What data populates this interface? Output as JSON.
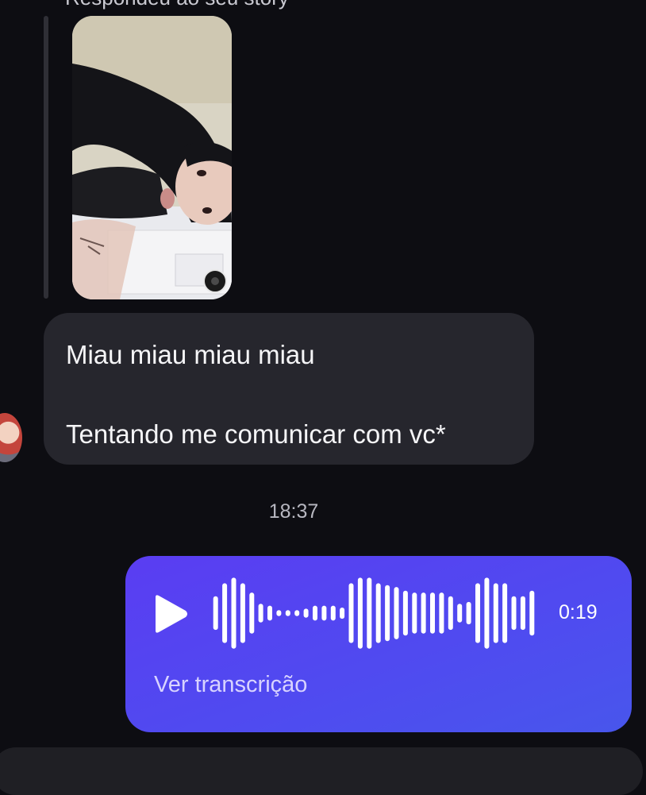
{
  "reply_header": {
    "text": "Respondeu ao seu story"
  },
  "story": {
    "thumbnail_icon": "story-photo",
    "badge_icon": "camera-lens-icon"
  },
  "incoming_message": {
    "line1": "Miau miau miau miau",
    "line2": "Tentando me comunicar com vc*"
  },
  "timestamp": "18:37",
  "voice_message": {
    "play_icon": "play-icon",
    "duration": "0:19",
    "transcript_link": "Ver transcrição",
    "waveform_levels": [
      0.45,
      0.8,
      0.95,
      0.8,
      0.55,
      0.25,
      0.2,
      0.08,
      0.08,
      0.08,
      0.12,
      0.2,
      0.2,
      0.2,
      0.15,
      0.8,
      0.95,
      0.95,
      0.8,
      0.75,
      0.7,
      0.6,
      0.55,
      0.55,
      0.55,
      0.55,
      0.45,
      0.25,
      0.3,
      0.8,
      0.95,
      0.8,
      0.8,
      0.45,
      0.45,
      0.6
    ]
  },
  "colors": {
    "background": "#0d0d12",
    "incoming_bubble": "#26262d",
    "outgoing_bubble": "#5a3df2",
    "transcript_link": "#d8d3ff"
  }
}
